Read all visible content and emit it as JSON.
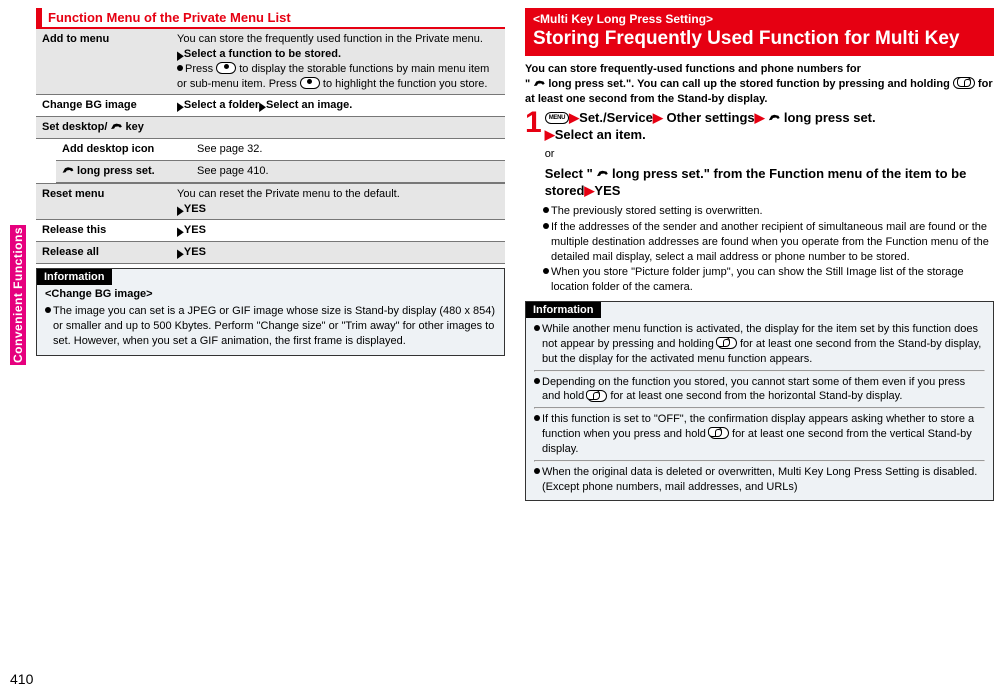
{
  "sideTab": "Convenient Functions",
  "pageNumber": "410",
  "left": {
    "sectionTitle": "Function Menu of the Private Menu List",
    "rows": {
      "addToMenu": {
        "label": "Add to menu",
        "text1": "You can store the frequently used function in the Private menu.",
        "selectLine": "Select a function to be stored.",
        "pressLinePrefix": "Press ",
        "pressLineMid": " to display the storable functions by main menu item or sub-menu item. Press ",
        "pressLineEnd": " to highlight the function you store."
      },
      "changeBg": {
        "label": "Change BG image",
        "text": "Select a folder",
        "text2": "Select an image."
      },
      "setDesktop": {
        "label": "Set desktop/ ",
        "keySuffix": " key"
      },
      "addDesktopIcon": {
        "label": "Add desktop icon",
        "text": "See page 32."
      },
      "longPressSet": {
        "labelPrefix": " long press set.",
        "text": "See page 410."
      },
      "resetMenu": {
        "label": "Reset menu",
        "text": "You can reset the Private menu to the default.",
        "yes": "YES"
      },
      "releaseThis": {
        "label": "Release this",
        "yes": "YES"
      },
      "releaseAll": {
        "label": "Release all",
        "yes": "YES"
      }
    },
    "info": {
      "label": "Information",
      "heading": "<Change BG image>",
      "body": "The image you can set is a JPEG or GIF image whose size is Stand-by display (480 x 854) or smaller and up to 500 Kbytes. Perform \"Change size\" or \"Trim away\" for other images to set. However, when you set a GIF animation, the first frame is displayed."
    }
  },
  "right": {
    "headerSmall": "<Multi Key Long Press Setting>",
    "headerBig": "Storing Frequently Used Function for Multi Key",
    "intro1": "You can store frequently-used functions and phone numbers for",
    "intro2a": "\" ",
    "intro2b": " long press set.\". You can call up the stored function by pressing and holding ",
    "intro2c": " for at least one second from the Stand-by display.",
    "step": {
      "set": "Set./Service",
      "other": " Other settings",
      "longpress": " long press set.",
      "select": "Select an item.",
      "or": "or",
      "alt1a": "Select \" ",
      "alt1b": " long press set.\" from the Function menu of the item to be stored",
      "yes": "YES"
    },
    "bullets": {
      "b1": "The previously stored setting is overwritten.",
      "b2": "If the addresses of the sender and another recipient of simultaneous mail are found or the multiple destination addresses are found when you operate from the Function menu of the detailed mail display, select a mail address or phone number to be stored.",
      "b3": "When you store \"Picture folder jump\", you can show the Still Image list of the storage location folder of the camera."
    },
    "info": {
      "label": "Information",
      "p1a": "While another menu function is activated, the display for the item set by this function does not appear by pressing and holding ",
      "p1b": " for at least one second from the Stand-by display, but the display for the activated menu function appears.",
      "p2a": "Depending on the function you stored, you cannot start some of them even if you press and hold ",
      "p2b": " for at least one second from the horizontal Stand-by display.",
      "p3a": "If this function is set to \"OFF\", the confirmation display appears asking whether to store a function when you press and hold ",
      "p3b": " for at least one second from the vertical Stand-by display.",
      "p4": "When the original data is deleted or overwritten, Multi Key Long Press Setting is disabled. (Except phone numbers, mail addresses, and URLs)"
    }
  }
}
